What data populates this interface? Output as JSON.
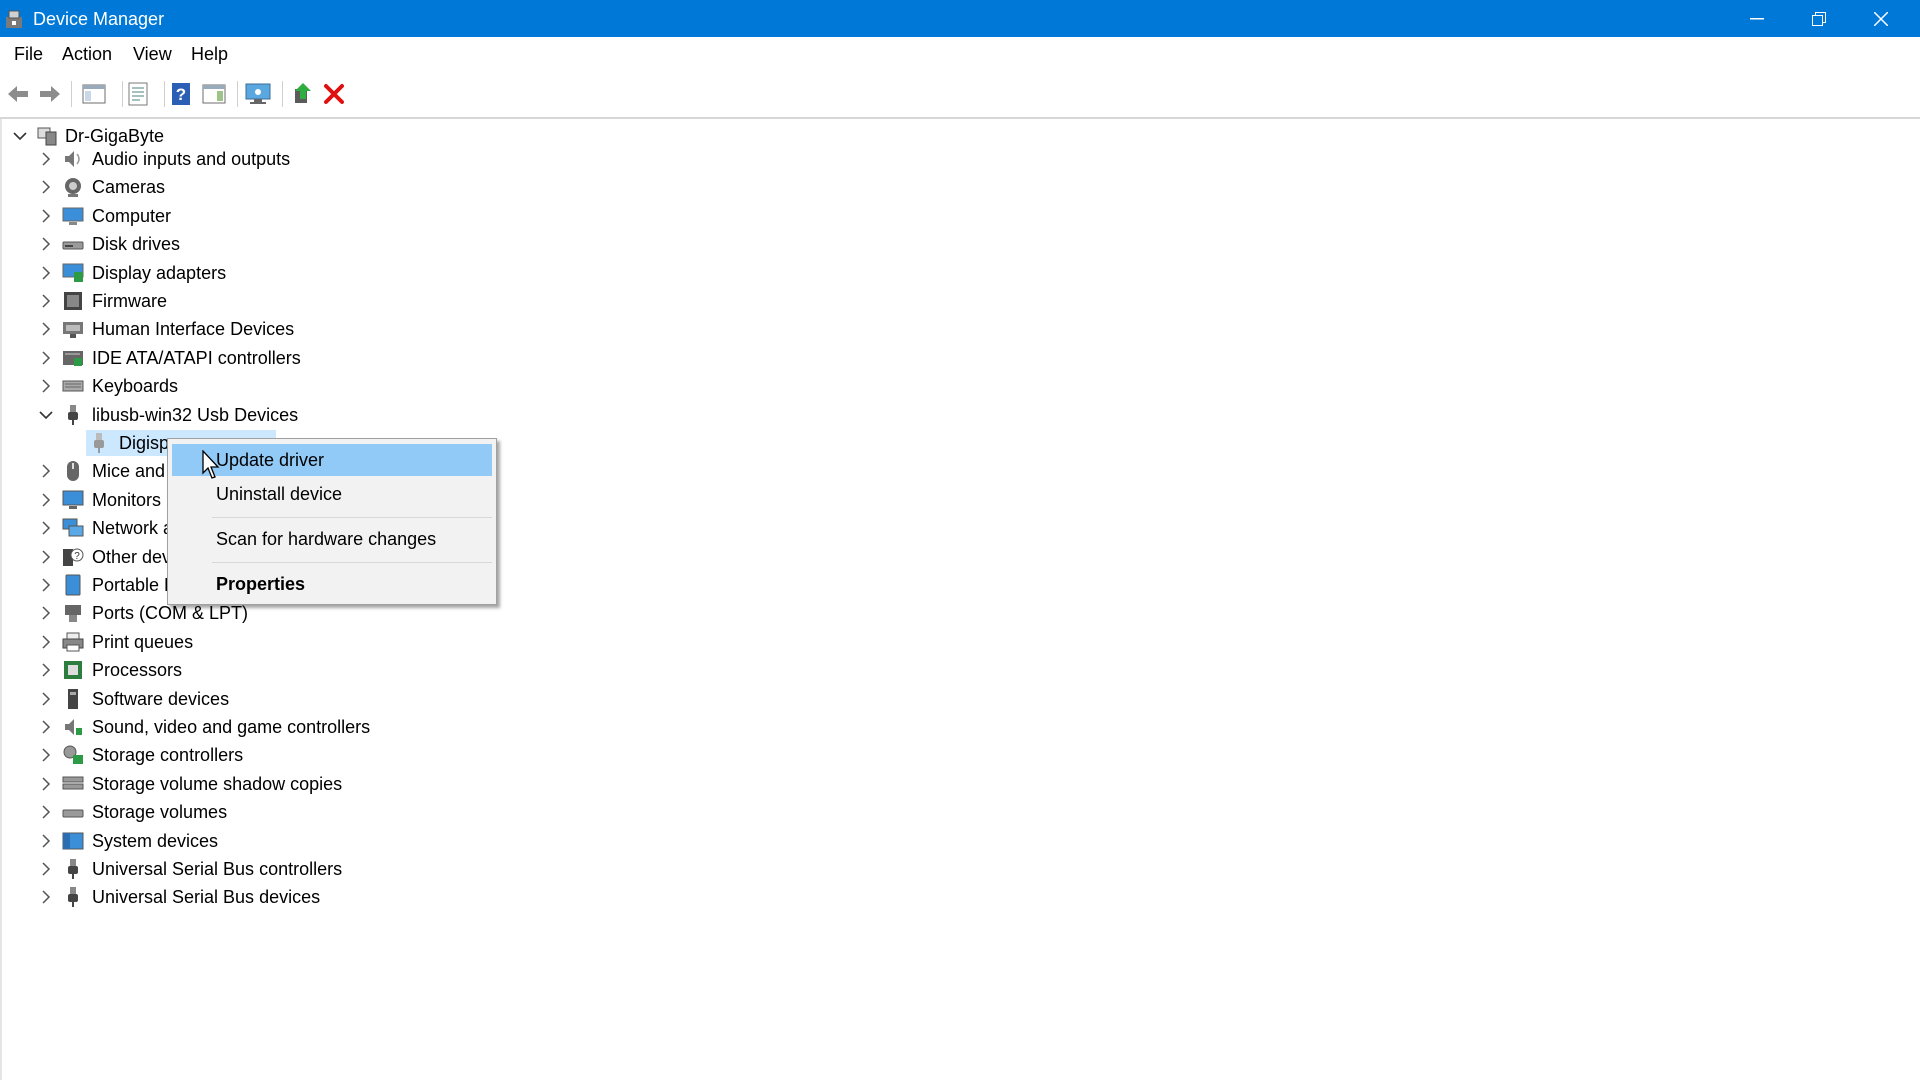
{
  "window": {
    "title": "Device Manager",
    "controls": [
      "minimize",
      "restore",
      "close"
    ]
  },
  "menubar": {
    "items": [
      "File",
      "Action",
      "View",
      "Help"
    ]
  },
  "toolbar": {
    "buttons": [
      "back-icon",
      "forward-icon",
      "show-hide-console-tree-icon",
      "properties-icon",
      "help-icon",
      "show-hide-action-pane-icon",
      "scan-hardware-icon",
      "update-driver-icon",
      "uninstall-icon"
    ]
  },
  "tree": {
    "root": "Dr-GigaByte",
    "categories": [
      {
        "label": "Audio inputs and outputs",
        "icon": "speaker-icon",
        "expanded": false
      },
      {
        "label": "Cameras",
        "icon": "camera-icon",
        "expanded": false
      },
      {
        "label": "Computer",
        "icon": "computer-icon",
        "expanded": false
      },
      {
        "label": "Disk drives",
        "icon": "disk-drive-icon",
        "expanded": false
      },
      {
        "label": "Display adapters",
        "icon": "display-adapter-icon",
        "expanded": false
      },
      {
        "label": "Firmware",
        "icon": "firmware-icon",
        "expanded": false
      },
      {
        "label": "Human Interface Devices",
        "icon": "hid-icon",
        "expanded": false
      },
      {
        "label": "IDE ATA/ATAPI controllers",
        "icon": "ide-controller-icon",
        "expanded": false
      },
      {
        "label": "Keyboards",
        "icon": "keyboard-icon",
        "expanded": false
      },
      {
        "label": "libusb-win32 Usb Devices",
        "icon": "usb-plug-icon",
        "expanded": true
      },
      {
        "label": "Mice and o",
        "icon": "mouse-icon",
        "expanded": false
      },
      {
        "label": "Monitors",
        "icon": "monitor-icon",
        "expanded": false
      },
      {
        "label": "Network a",
        "icon": "network-icon",
        "expanded": false
      },
      {
        "label": "Other devi",
        "icon": "other-devices-icon",
        "expanded": false
      },
      {
        "label": "Portable D",
        "icon": "portable-device-icon",
        "expanded": false
      },
      {
        "label": "Ports (COM & LPT)",
        "icon": "port-icon",
        "expanded": false
      },
      {
        "label": "Print queues",
        "icon": "printer-icon",
        "expanded": false
      },
      {
        "label": "Processors",
        "icon": "processor-icon",
        "expanded": false
      },
      {
        "label": "Software devices",
        "icon": "software-device-icon",
        "expanded": false
      },
      {
        "label": "Sound, video and game controllers",
        "icon": "sound-icon",
        "expanded": false
      },
      {
        "label": "Storage controllers",
        "icon": "storage-controller-icon",
        "expanded": false
      },
      {
        "label": "Storage volume shadow copies",
        "icon": "shadow-copy-icon",
        "expanded": false
      },
      {
        "label": "Storage volumes",
        "icon": "storage-volume-icon",
        "expanded": false
      },
      {
        "label": "System devices",
        "icon": "system-devices-icon",
        "expanded": false
      },
      {
        "label": "Universal Serial Bus controllers",
        "icon": "usb-plug-icon",
        "expanded": false
      },
      {
        "label": "Universal Serial Bus devices",
        "icon": "usb-plug-icon",
        "expanded": false
      }
    ],
    "child_device": "Digispa"
  },
  "context_menu": {
    "items": [
      {
        "label": "Update driver",
        "highlighted": true,
        "bold": false
      },
      {
        "label": "Uninstall device",
        "highlighted": false,
        "bold": false
      },
      {
        "label": "Scan for hardware changes",
        "highlighted": false,
        "bold": false
      },
      {
        "label": "Properties",
        "highlighted": false,
        "bold": true
      }
    ]
  },
  "colors": {
    "titlebar": "#0078d7",
    "context_highlight": "#91c9f7",
    "selection": "#cce8ff",
    "uninstall_red": "#e01010"
  }
}
